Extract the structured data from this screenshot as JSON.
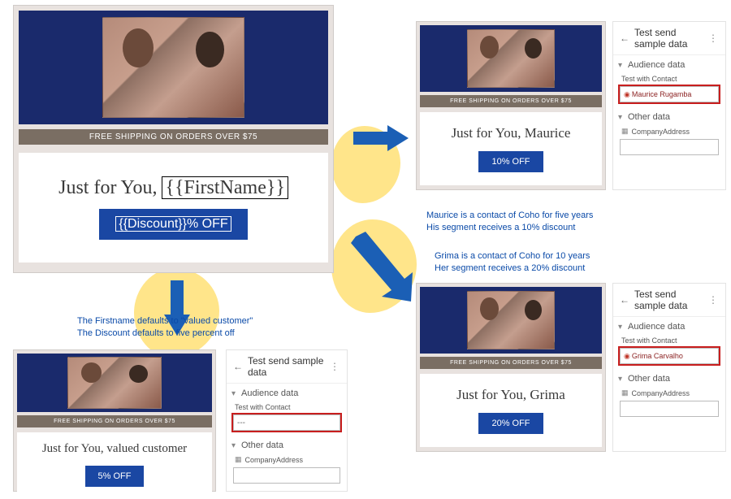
{
  "template": {
    "ship_bar": "FREE SHIPPING ON ORDERS OVER $75",
    "headline_prefix": "Just for You, ",
    "firstname_token": "{{FirstName}}",
    "discount_token": "{{Discount}}% OFF"
  },
  "panels": {
    "title": "Test send sample data",
    "audience_section": "Audience data",
    "other_section": "Other data",
    "test_with_contact": "Test with Contact",
    "company_address": "CompanyAddress",
    "empty_value": "---"
  },
  "previews": {
    "default": {
      "headline": "Just for You, valued customer",
      "cta": "5% OFF"
    },
    "maurice": {
      "headline": "Just for You, Maurice",
      "cta": "10% OFF",
      "contact": "Maurice Rugamba"
    },
    "grima": {
      "headline": "Just for You, Grima",
      "cta": "20% OFF",
      "contact": "Grima Carvalho"
    }
  },
  "captions": {
    "c1a": "The Firstname defaults to \"valued customer\"",
    "c1b": "The Discount defaults to five percent off",
    "c2a": "Maurice is a contact of Coho for five years",
    "c2b": "His segment receives a 10% discount",
    "c3a": "Grima is a contact of Coho for 10 years",
    "c3b": "Her segment receives a 20% discount"
  }
}
